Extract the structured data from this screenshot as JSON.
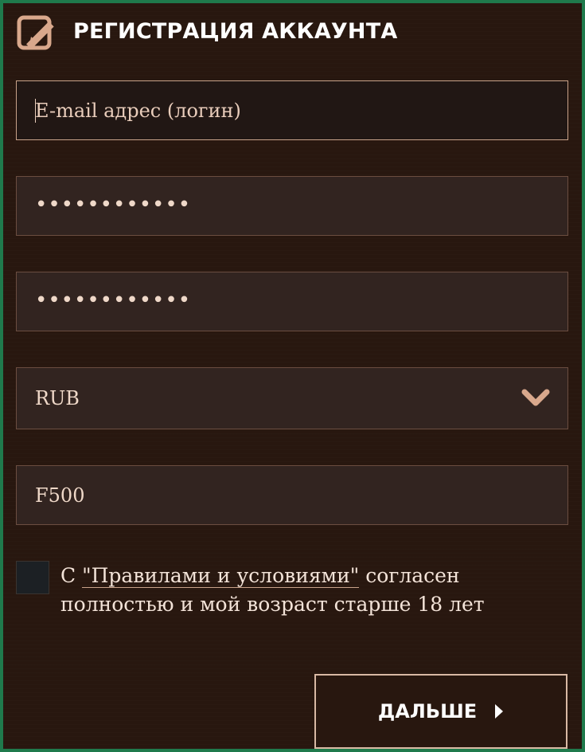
{
  "header": {
    "title": "РЕГИСТРАЦИЯ АККАУНТА",
    "icon": "edit-icon"
  },
  "form": {
    "email": {
      "placeholder": "E-mail адрес (логин)",
      "value": ""
    },
    "password": {
      "value": "••••••••••••"
    },
    "password_confirm": {
      "value": "••••••••••••"
    },
    "currency": {
      "value": "RUB",
      "icon": "chevron-down-icon"
    },
    "promo": {
      "value": "F500"
    },
    "agreement": {
      "checked": false,
      "prefix": "С ",
      "link": "\"Правилами и условиями\"",
      "suffix": " согласен полностью и мой возраст старше 18 лет"
    },
    "next_button": {
      "label": "ДАЛЬШЕ",
      "icon": "caret-right-icon"
    }
  },
  "colors": {
    "frame_border": "#1f7a4c",
    "background": "#28170f",
    "field_bg": "#322420",
    "field_border": "#6b4d40",
    "accent": "#d9a88c"
  }
}
